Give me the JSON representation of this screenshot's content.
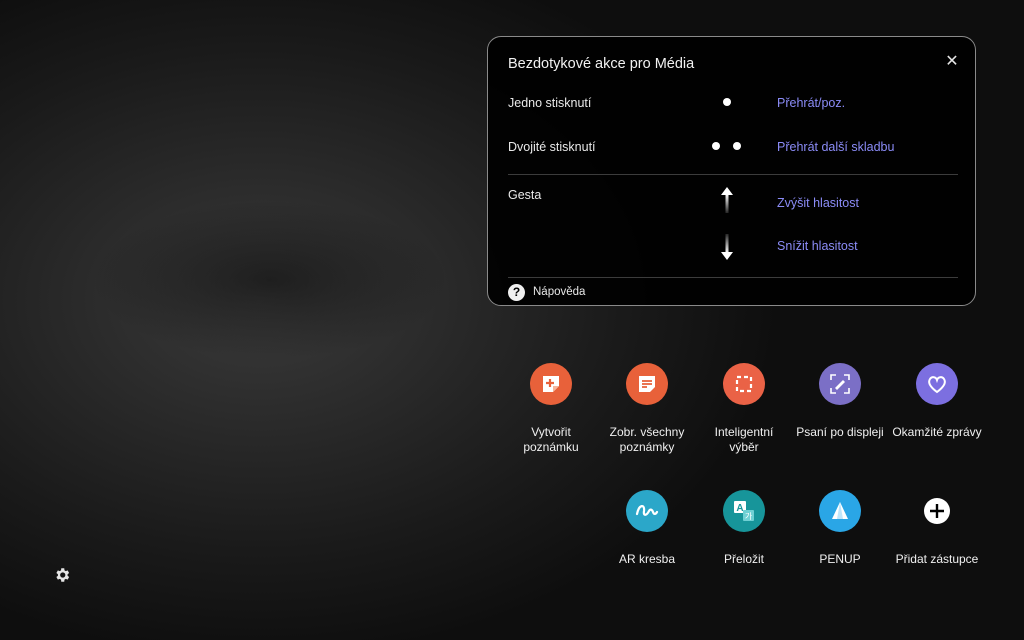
{
  "panel": {
    "title": "Bezdotykové akce pro Média",
    "close_glyph": "✕",
    "rows": [
      {
        "label": "Jedno stisknutí",
        "action": "Přehrát/poz."
      },
      {
        "label": "Dvojité stisknutí",
        "action": "Přehrát další skladbu"
      }
    ],
    "gestures_label": "Gesta",
    "gesture_up_action": "Zvýšit hlasitost",
    "gesture_down_action": "Snížit hlasitost",
    "help_glyph": "?",
    "help_label": "Nápověda",
    "action_color": "#8b8cf7"
  },
  "apps": [
    {
      "label_line1": "Vytvořit",
      "label_line2": "poznámku",
      "color": "#e8613a",
      "icon": "create-note-icon"
    },
    {
      "label_line1": "Zobr. všechny",
      "label_line2": "poznámky",
      "color": "#e8613a",
      "icon": "view-notes-icon"
    },
    {
      "label_line1": "Inteligentní",
      "label_line2": "výběr",
      "color": "#ea6246",
      "icon": "smart-select-icon"
    },
    {
      "label_line1": "Psaní po displeji",
      "label_line2": "",
      "color": "#7b6fc6",
      "icon": "screen-write-icon"
    },
    {
      "label_line1": "Okamžité zprávy",
      "label_line2": "",
      "color": "#7c6fe0",
      "icon": "live-message-icon"
    },
    {
      "label_line1": "AR kresba",
      "label_line2": "",
      "color": "#2ba7c9",
      "icon": "ar-doodle-icon"
    },
    {
      "label_line1": "Přeložit",
      "label_line2": "",
      "color": "#17959a",
      "icon": "translate-icon"
    },
    {
      "label_line1": "PENUP",
      "label_line2": "",
      "color": "#2aa6e6",
      "icon": "penup-icon"
    },
    {
      "label_line1": "Přidat zástupce",
      "label_line2": "",
      "color": "transparent",
      "icon": "add-shortcut-icon"
    }
  ],
  "settings_icon": "gear-icon"
}
